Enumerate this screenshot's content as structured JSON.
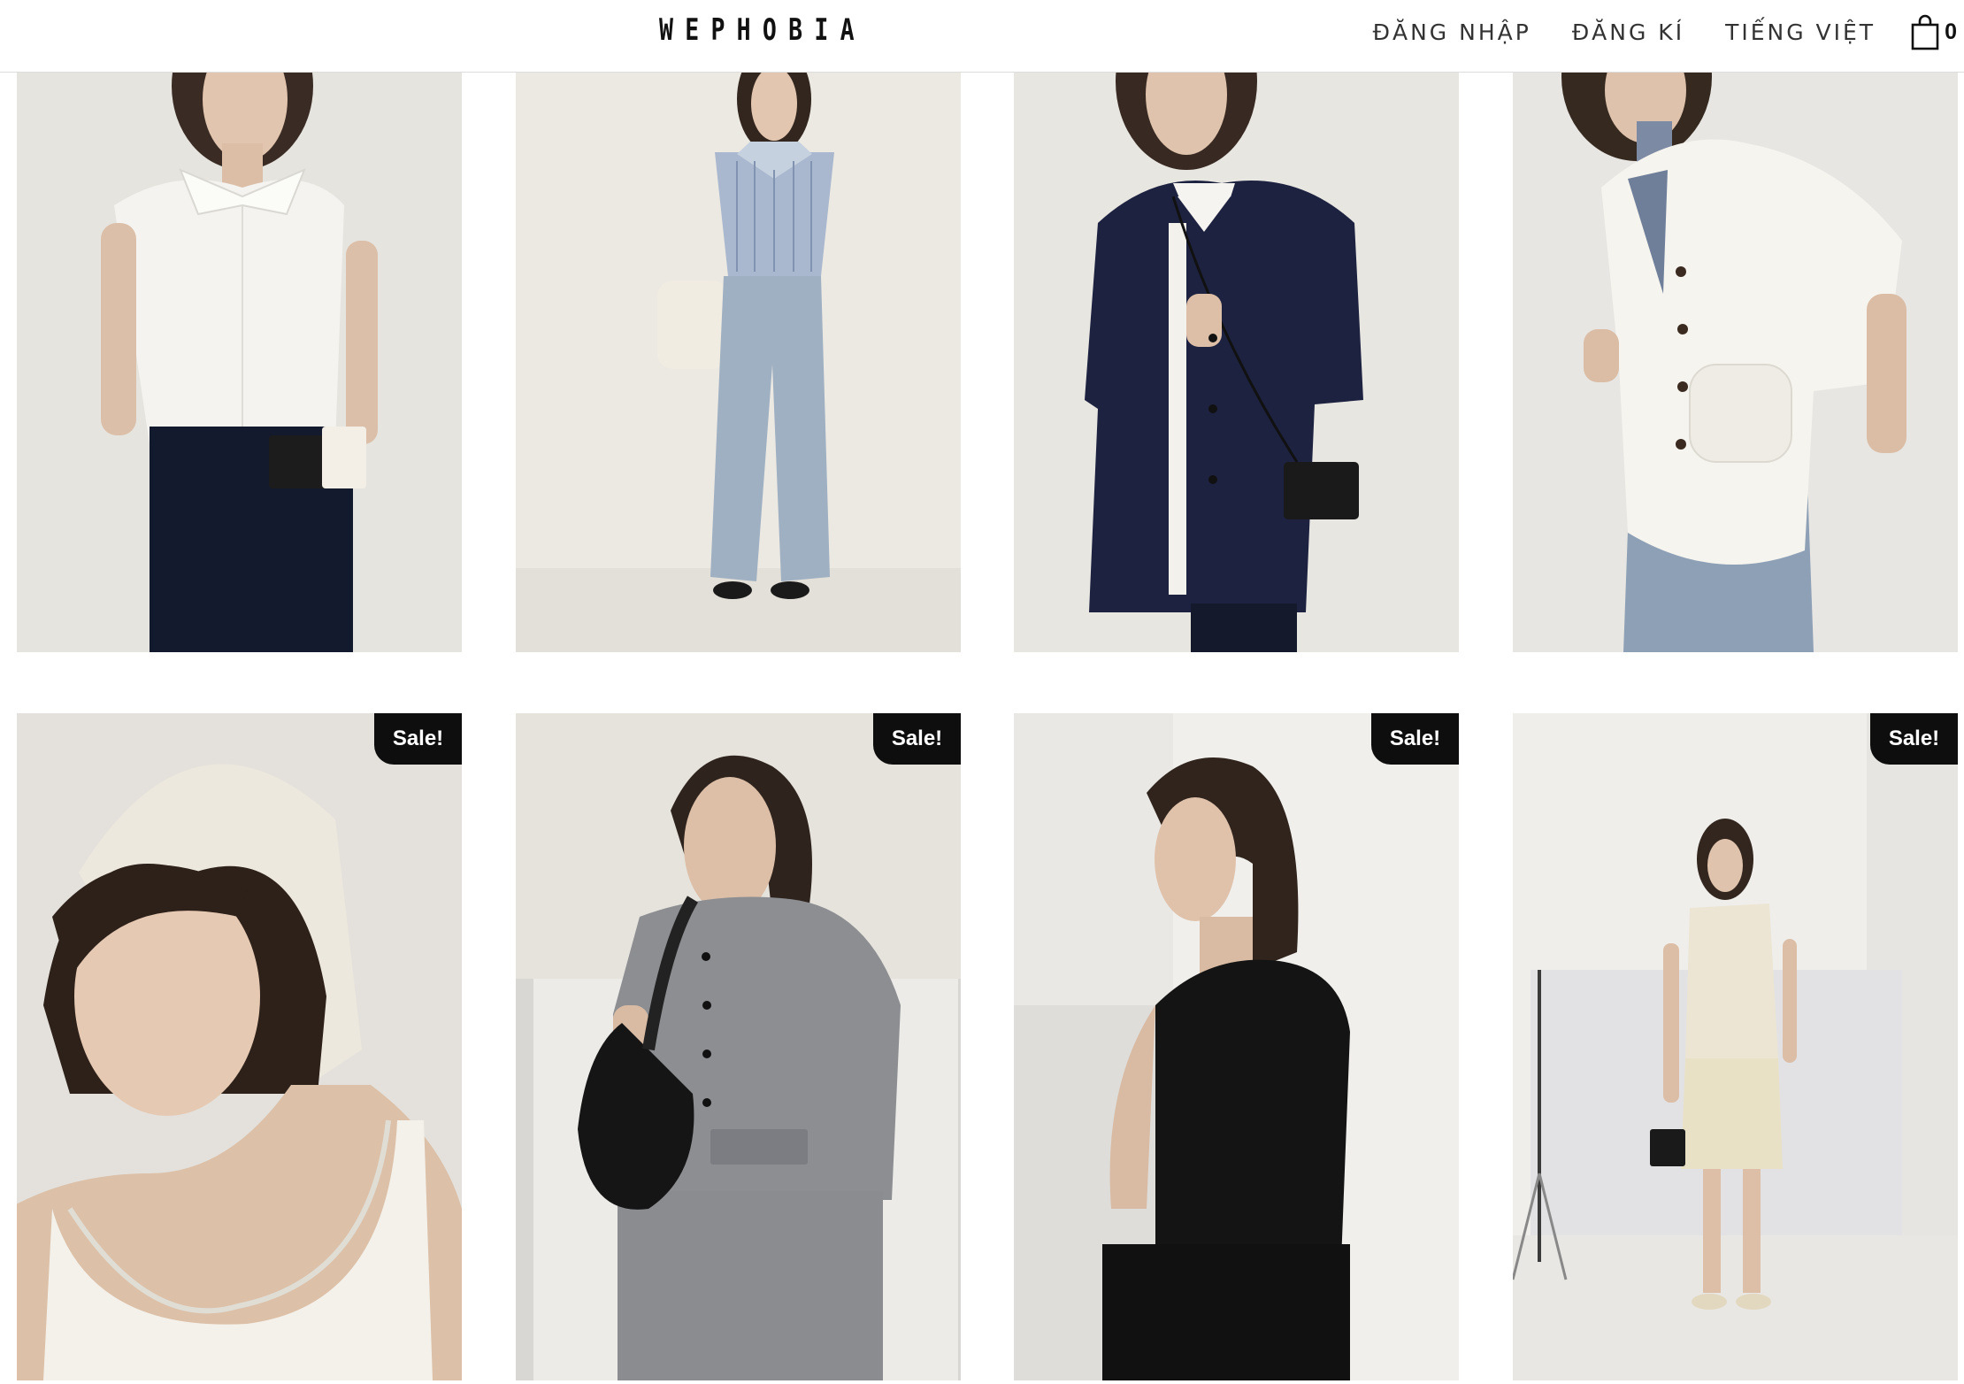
{
  "header": {
    "logo": "WEPHOBIA",
    "nav": {
      "login": "ĐĂNG NHẬP",
      "register": "ĐĂNG KÍ",
      "language": "TIẾNG VIỆT",
      "cart_icon": "shopping-bag-icon",
      "cart_count": "0"
    }
  },
  "products": [
    {
      "image": "sleeveless white collared shirt with navy trousers and black waist bag",
      "sale": false
    },
    {
      "image": "sleeveless blue striped shirt with light wash wide-leg jeans",
      "sale": false
    },
    {
      "image": "navy short-sleeve collarless jacket with crossbody bag",
      "sale": false
    },
    {
      "image": "white short-sleeve collarless jacket over striped shirt",
      "sale": false
    },
    {
      "image": "cream head scarf with white scoop-neck tank top",
      "sale": true,
      "badge": "Sale!"
    },
    {
      "image": "grey short-sleeve collarless blazer with grey trousers and black shoulder bag",
      "sale": true,
      "badge": "Sale!"
    },
    {
      "image": "black sleeveless draped top, back view",
      "sale": true,
      "badge": "Sale!"
    },
    {
      "image": "cream draped sleeveless top with knit mini skirt in studio",
      "sale": true,
      "badge": "Sale!"
    }
  ],
  "colors": {
    "background": "#ffffff",
    "text": "#333333",
    "sale_badge": "#0e0e0e",
    "header_border": "#dddddd"
  }
}
